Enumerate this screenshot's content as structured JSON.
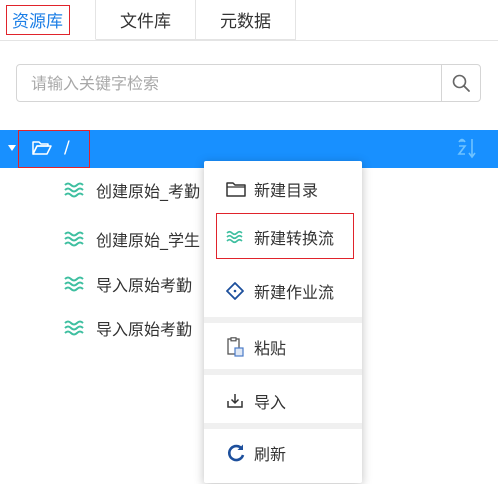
{
  "tabs": [
    {
      "label": "资源库",
      "active": true
    },
    {
      "label": "文件库",
      "active": false
    },
    {
      "label": "元数据",
      "active": false
    }
  ],
  "search": {
    "placeholder": "请输入关键字检索"
  },
  "tree": {
    "root": {
      "label": "/"
    },
    "items": [
      {
        "label": "创建原始_考勤"
      },
      {
        "label": "创建原始_学生"
      },
      {
        "label": "导入原始考勤"
      },
      {
        "label": "导入原始考勤"
      }
    ]
  },
  "context_menu": {
    "items": [
      {
        "label": "新建目录",
        "icon": "folder-icon"
      },
      {
        "label": "新建转换流",
        "icon": "wave-icon"
      },
      {
        "label": "新建作业流",
        "icon": "diamond-icon"
      },
      {
        "label": "粘贴",
        "icon": "paste-icon"
      },
      {
        "label": "导入",
        "icon": "import-icon"
      },
      {
        "label": "刷新",
        "icon": "refresh-icon"
      }
    ]
  },
  "colors": {
    "accent": "#1890ff",
    "highlight_border": "#e0232b",
    "wave": "#3ebfa0"
  }
}
